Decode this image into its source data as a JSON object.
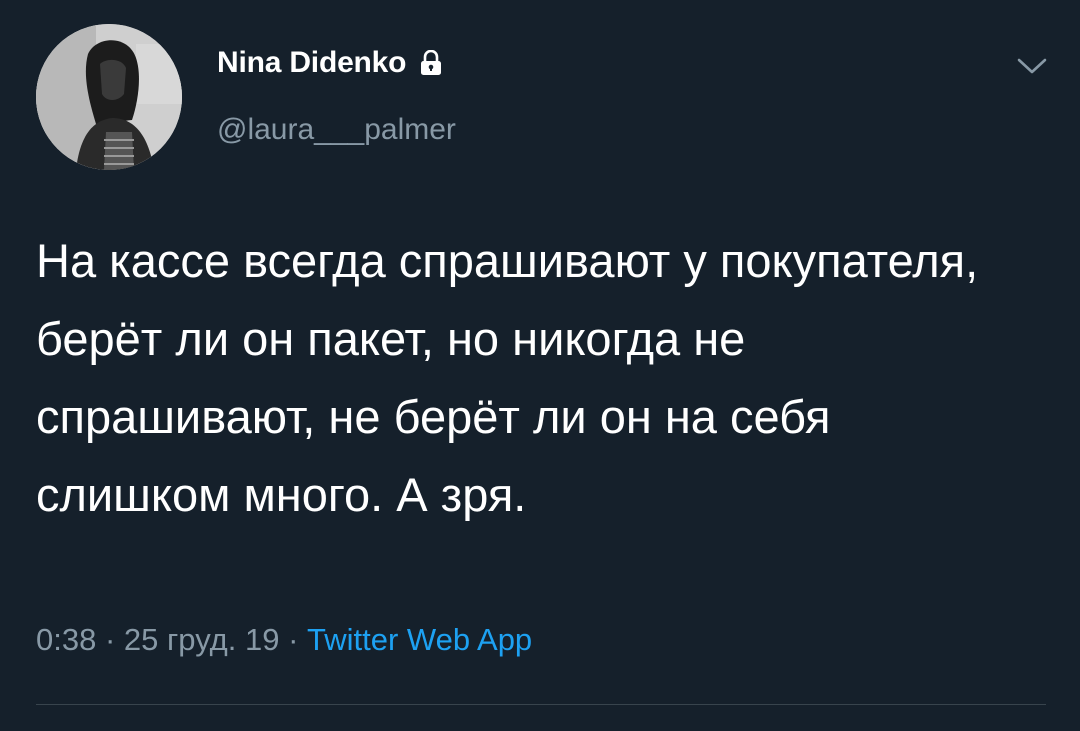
{
  "tweet": {
    "author": {
      "display_name": "Nina Didenko",
      "handle": "@laura___palmer",
      "protected_icon": "lock-icon",
      "avatar_icon": "avatar-photo"
    },
    "menu_icon": "chevron-down-icon",
    "text": "На кассе всегда спрашивают у покупателя, берёт ли он пакет, но никогда не спрашивают, не берёт ли он на себя слишком много. А зря.",
    "time": "0:38",
    "date": "25 груд. 19",
    "source": "Twitter Web App",
    "separator": " · "
  },
  "colors": {
    "background": "#15202b",
    "text_primary": "#ffffff",
    "text_secondary": "#8899a6",
    "link": "#1da1f2",
    "divider": "#38444d"
  }
}
